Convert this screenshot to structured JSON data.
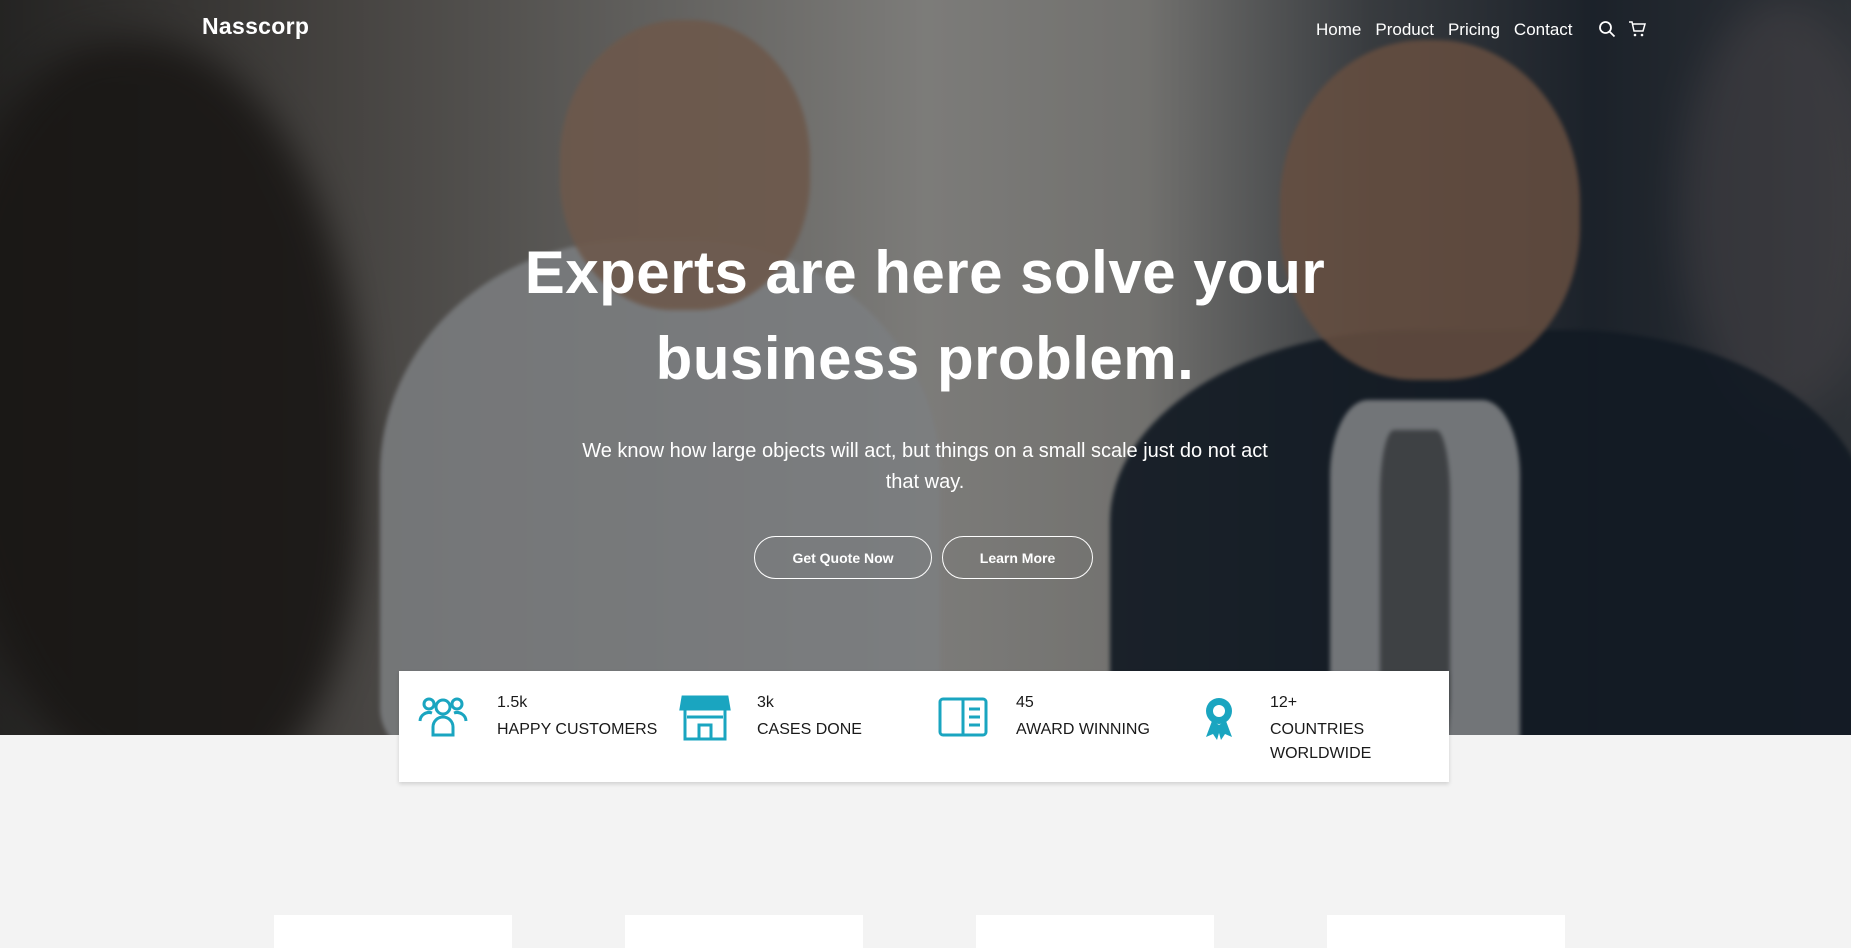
{
  "brand": "Nasscorp",
  "nav": {
    "items": [
      "Home",
      "Product",
      "Pricing",
      "Contact"
    ],
    "icons": [
      "search-icon",
      "cart-icon"
    ]
  },
  "hero": {
    "title_line1": "Experts are here solve your",
    "title_line2": "business problem.",
    "subtitle": "We know how large objects will act, but things on a small scale just do not act that way.",
    "primary_button": "Get Quote Now",
    "secondary_button": "Learn More"
  },
  "stats": [
    {
      "value": "1.5k",
      "label": "HAPPY CUSTOMERS",
      "icon": "users-icon"
    },
    {
      "value": "3k",
      "label": "CASES DONE",
      "icon": "store-icon"
    },
    {
      "value": "45",
      "label": "AWARD WINNING",
      "icon": "book-icon"
    },
    {
      "value": "12+",
      "label": "COUNTRIES WORLDWIDE",
      "icon": "award-ribbon-icon"
    }
  ],
  "colors": {
    "accent": "#1aa5c0",
    "page_background": "#f3f3f3"
  }
}
